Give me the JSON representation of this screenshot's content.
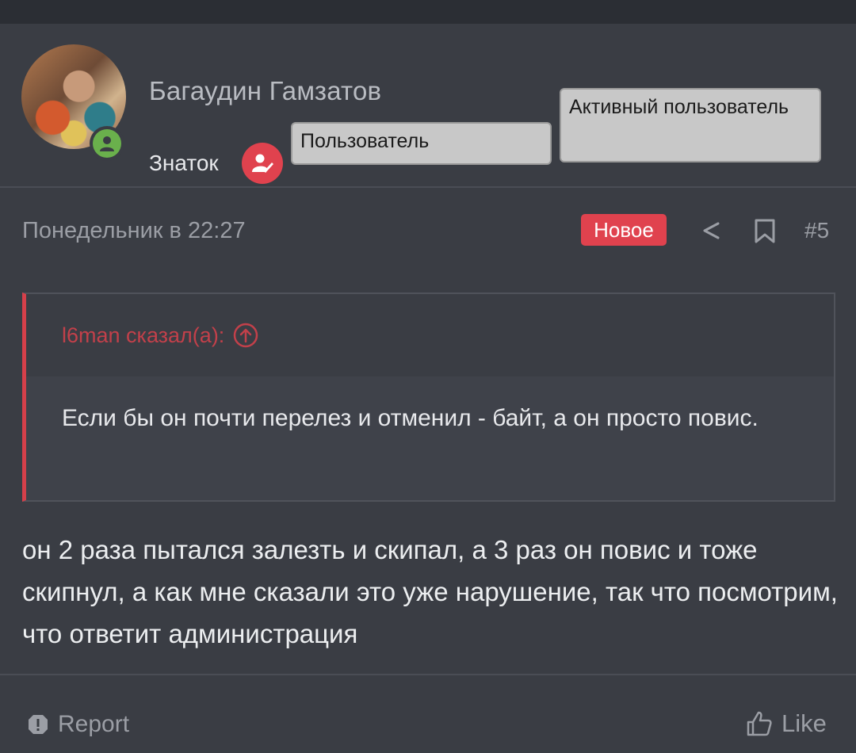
{
  "header": {
    "username": "Багаудин Гамзатов",
    "rank": "Знаток",
    "tags": [
      "Пользователь",
      "Активный пользователь"
    ]
  },
  "post": {
    "date": "Понедельник в 22:27",
    "new_label": "Новое",
    "number": "#5"
  },
  "quote": {
    "author": "l6man сказал(а):",
    "text": "Если бы он почти перелез и отменил - байт, а он просто повис."
  },
  "message": "он 2 раза пытался залезть и скипал, а 3 раз он повис и тоже скипнул, а как мне сказали это уже нарушение, так что посмотрим, что ответит администрация",
  "footer": {
    "report_label": "Report",
    "like_label": "Like"
  },
  "colors": {
    "accent": "#e0424e",
    "background": "#3a3d44",
    "online": "#6ab04c"
  }
}
